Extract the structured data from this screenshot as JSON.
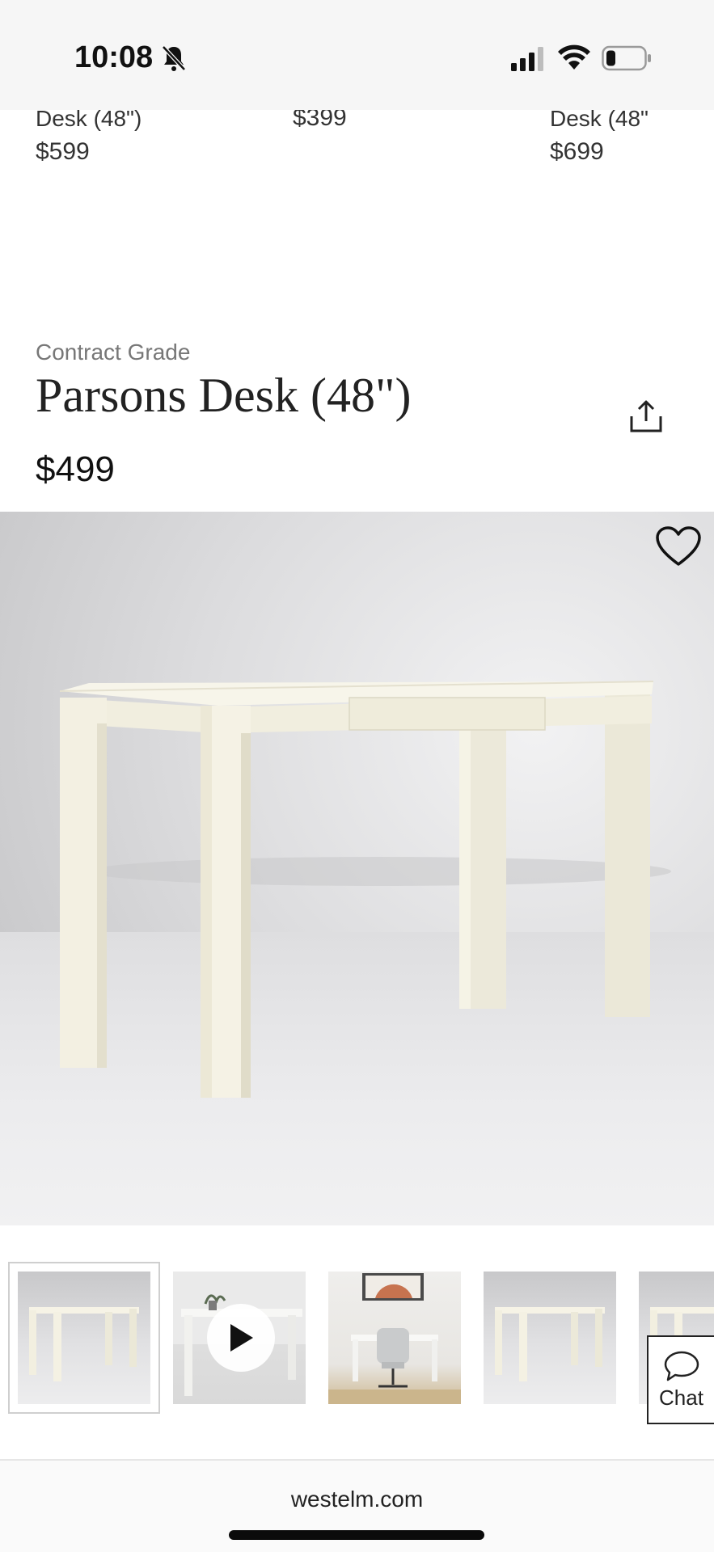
{
  "status_bar": {
    "time": "10:08",
    "icons": [
      "bell-slash-icon",
      "cellular-signal-icon",
      "wifi-icon",
      "battery-low-icon"
    ]
  },
  "related_products": [
    {
      "name": "Desk (48\")",
      "price": "$599"
    },
    {
      "name": "",
      "price": "$399"
    },
    {
      "name": "Desk (48\"",
      "price": "$699"
    }
  ],
  "product": {
    "brand": "Contract Grade",
    "title": "Parsons Desk (48\")",
    "price": "$499"
  },
  "icons": {
    "share": "share-icon",
    "favorite": "heart-icon",
    "play": "play-icon",
    "chat": "chat-bubble-icon"
  },
  "gallery": {
    "thumbnail_count": 5,
    "selected_index": 0,
    "video_thumbnail_index": 1
  },
  "chat": {
    "label": "Chat"
  },
  "browser": {
    "url": "westelm.com"
  },
  "colors": {
    "desk": "#f4f1e3",
    "backdrop": "#d6d6d8",
    "accent": "#111111"
  }
}
